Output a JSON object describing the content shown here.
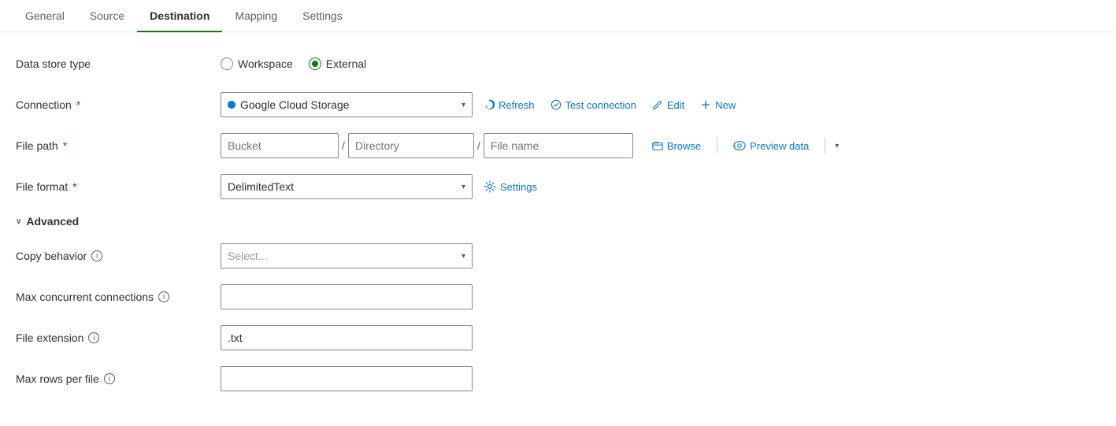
{
  "tabs": [
    {
      "id": "general",
      "label": "General",
      "active": false
    },
    {
      "id": "source",
      "label": "Source",
      "active": false
    },
    {
      "id": "destination",
      "label": "Destination",
      "active": true
    },
    {
      "id": "mapping",
      "label": "Mapping",
      "active": false
    },
    {
      "id": "settings",
      "label": "Settings",
      "active": false
    }
  ],
  "form": {
    "data_store_type": {
      "label": "Data store type",
      "options": [
        "Workspace",
        "External"
      ],
      "selected": "External"
    },
    "connection": {
      "label": "Connection",
      "required": true,
      "selected": "Google Cloud Storage",
      "buttons": {
        "refresh": "Refresh",
        "test": "Test connection",
        "edit": "Edit",
        "new": "New"
      }
    },
    "file_path": {
      "label": "File path",
      "required": true,
      "bucket_placeholder": "Bucket",
      "directory_placeholder": "Directory",
      "filename_placeholder": "File name",
      "browse_label": "Browse",
      "preview_label": "Preview data"
    },
    "file_format": {
      "label": "File format",
      "required": true,
      "selected": "DelimitedText",
      "settings_label": "Settings"
    },
    "advanced": {
      "label": "Advanced",
      "expanded": true
    },
    "copy_behavior": {
      "label": "Copy behavior",
      "placeholder": "Select...",
      "has_info": true
    },
    "max_concurrent": {
      "label": "Max concurrent connections",
      "value": "",
      "has_info": true
    },
    "file_extension": {
      "label": "File extension",
      "value": ".txt",
      "has_info": true
    },
    "max_rows_per_file": {
      "label": "Max rows per file",
      "value": "",
      "has_info": true
    }
  }
}
